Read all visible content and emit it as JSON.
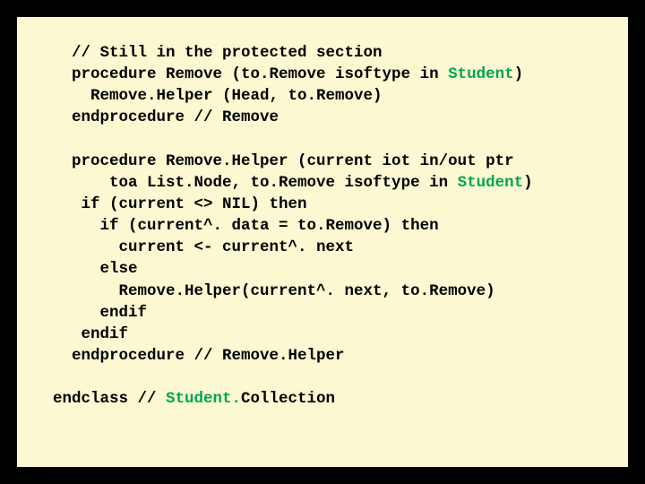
{
  "code": {
    "l1": "  // Still in the protected section",
    "l2a": "  procedure Remove (to.Remove isoftype in ",
    "l2b": "Student",
    "l2c": ")",
    "l3": "    Remove.Helper (Head, to.Remove)",
    "l4": "  endprocedure // Remove",
    "blank1": "",
    "l5": "  procedure Remove.Helper (current iot in/out ptr",
    "l6a": "      toa List.Node, to.Remove isoftype in ",
    "l6b": "Student",
    "l6c": ")",
    "l7": "   if (current <> NIL) then",
    "l8": "     if (current^. data = to.Remove) then",
    "l9": "       current <- current^. next",
    "l10": "     else",
    "l11": "       Remove.Helper(current^. next, to.Remove)",
    "l12": "     endif",
    "l13": "   endif",
    "l14": "  endprocedure // Remove.Helper",
    "blank2": "",
    "l15a": "endclass // ",
    "l15b": "Student.",
    "l15c": "Collection"
  }
}
